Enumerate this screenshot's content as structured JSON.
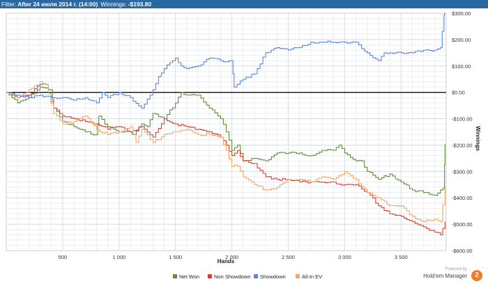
{
  "filter": {
    "label": "Filter:",
    "value": "After 24 июля 2014 г. (14:00)",
    "winnings_label": "Winnings:",
    "winnings_value": "-$193.80"
  },
  "branding": {
    "powered": "Powered by",
    "name": "Hold'em Manager",
    "logo_glyph": "2"
  },
  "chart_data": {
    "type": "line",
    "xlabel": "Hands",
    "ylabel": "Winnings",
    "xlim": [
      0,
      3900
    ],
    "ylim": [
      -600,
      300
    ],
    "x_ticks": [
      500,
      1000,
      1500,
      2000,
      2500,
      3000,
      3500
    ],
    "x_tick_labels": [
      "500",
      "1 000",
      "1 500",
      "2 000",
      "2 500",
      "3 000",
      "3 500"
    ],
    "y_ticks": [
      300,
      200,
      100,
      0,
      -100,
      -200,
      -300,
      -400,
      -500,
      -600
    ],
    "y_tick_labels": [
      "$300.00",
      "$200.00",
      "$100.00",
      "$0.00",
      "-$100.00",
      "-$200.00",
      "-$300.00",
      "-$400.00",
      "-$500.00",
      "-$600.00"
    ],
    "grid": true,
    "legend_position": "bottom",
    "series": [
      {
        "name": "Net Won",
        "color": "#5b8f3a",
        "x": [
          0,
          100,
          200,
          300,
          400,
          420,
          500,
          600,
          700,
          800,
          820,
          900,
          1000,
          1100,
          1130,
          1200,
          1250,
          1300,
          1400,
          1500,
          1550,
          1600,
          1700,
          1800,
          1900,
          1950,
          2000,
          2050,
          2100,
          2200,
          2300,
          2400,
          2500,
          2600,
          2700,
          2800,
          2900,
          2950,
          3000,
          3100,
          3150,
          3200,
          3300,
          3400,
          3500,
          3600,
          3700,
          3800,
          3850,
          3880,
          3890
        ],
        "y": [
          0,
          -40,
          -20,
          20,
          10,
          -60,
          -110,
          -130,
          -150,
          -160,
          -90,
          -130,
          -150,
          -150,
          -160,
          -120,
          -130,
          -80,
          -100,
          -40,
          0,
          -10,
          -10,
          -60,
          -100,
          -150,
          -220,
          -200,
          -260,
          -250,
          -260,
          -230,
          -230,
          -230,
          -240,
          -220,
          -220,
          -200,
          -230,
          -260,
          -260,
          -300,
          -330,
          -310,
          -340,
          -370,
          -380,
          -390,
          -370,
          -360,
          -195
        ]
      },
      {
        "name": "Non Showdown",
        "color": "#e23b2e",
        "x": [
          0,
          100,
          200,
          300,
          350,
          420,
          500,
          600,
          700,
          800,
          900,
          1000,
          1100,
          1200,
          1300,
          1400,
          1500,
          1600,
          1700,
          1800,
          1900,
          1950,
          2000,
          2050,
          2100,
          2200,
          2300,
          2400,
          2500,
          2600,
          2700,
          2800,
          2900,
          3000,
          3100,
          3200,
          3300,
          3400,
          3500,
          3600,
          3700,
          3800,
          3850,
          3890
        ],
        "y": [
          0,
          -20,
          -10,
          30,
          30,
          -60,
          -90,
          -100,
          -110,
          -120,
          -140,
          -130,
          -150,
          -130,
          -170,
          -100,
          -120,
          -130,
          -140,
          -150,
          -170,
          -200,
          -240,
          -220,
          -260,
          -270,
          -320,
          -330,
          -330,
          -340,
          -340,
          -340,
          -340,
          -350,
          -350,
          -380,
          -430,
          -460,
          -470,
          -490,
          -510,
          -530,
          -540,
          -490
        ]
      },
      {
        "name": "Showdown",
        "color": "#5b84e0",
        "x": [
          0,
          100,
          200,
          300,
          400,
          500,
          600,
          700,
          800,
          850,
          900,
          1000,
          1100,
          1200,
          1300,
          1350,
          1400,
          1500,
          1550,
          1600,
          1700,
          1800,
          1900,
          2000,
          2020,
          2100,
          2200,
          2300,
          2400,
          2500,
          2600,
          2700,
          2800,
          2900,
          3000,
          3100,
          3200,
          3300,
          3350,
          3400,
          3500,
          3600,
          3700,
          3800,
          3850,
          3880,
          3890
        ],
        "y": [
          0,
          -10,
          -20,
          -10,
          -20,
          -20,
          -30,
          -20,
          -40,
          0,
          -20,
          0,
          -20,
          -60,
          10,
          60,
          90,
          130,
          100,
          90,
          100,
          130,
          120,
          120,
          20,
          50,
          70,
          150,
          170,
          160,
          170,
          190,
          190,
          190,
          190,
          190,
          150,
          120,
          150,
          150,
          150,
          150,
          160,
          160,
          170,
          290,
          300
        ]
      },
      {
        "name": "All-In EV",
        "color": "#f5a665",
        "x": [
          0,
          100,
          200,
          300,
          350,
          420,
          500,
          600,
          700,
          800,
          900,
          1000,
          1100,
          1150,
          1200,
          1300,
          1400,
          1500,
          1600,
          1700,
          1800,
          1900,
          1950,
          2000,
          2050,
          2100,
          2200,
          2300,
          2400,
          2500,
          2600,
          2700,
          2800,
          2900,
          3000,
          3100,
          3200,
          3300,
          3400,
          3500,
          3600,
          3700,
          3800,
          3850,
          3890
        ],
        "y": [
          0,
          -20,
          10,
          40,
          30,
          -80,
          -120,
          -110,
          -90,
          -140,
          -160,
          -150,
          -130,
          -190,
          -140,
          -190,
          -160,
          -150,
          -140,
          -160,
          -160,
          -170,
          -220,
          -280,
          -280,
          -320,
          -350,
          -370,
          -360,
          -330,
          -330,
          -340,
          -320,
          -330,
          -300,
          -330,
          -380,
          -400,
          -430,
          -430,
          -470,
          -490,
          -480,
          -490,
          -360
        ]
      }
    ]
  }
}
